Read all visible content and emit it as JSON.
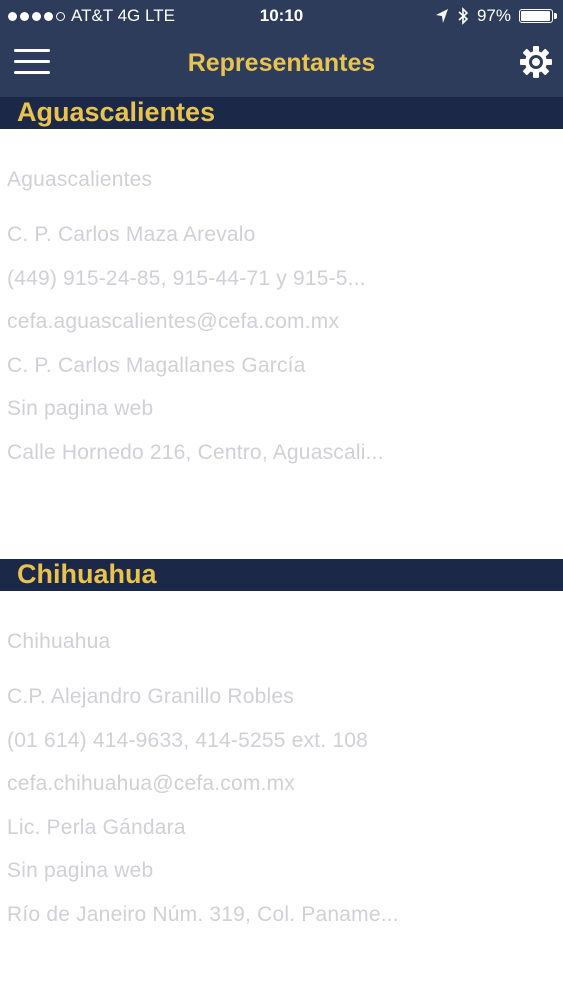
{
  "status_bar": {
    "carrier": "AT&T 4G  LTE",
    "time": "10:10",
    "battery": "97%",
    "battery_level": 0.97
  },
  "nav": {
    "title": "Representantes"
  },
  "sections": [
    {
      "header": "Aguascalientes",
      "lines": [
        "Aguascalientes",
        "C. P. Carlos Maza Arevalo",
        "(449) 915-24-85, 915-44-71 y 915-5...",
        "cefa.aguascalientes@cefa.com.mx",
        "C. P. Carlos Magallanes García",
        "Sin pagina web",
        "Calle Hornedo 216, Centro, Aguascali..."
      ]
    },
    {
      "header": "Chihuahua",
      "lines": [
        "Chihuahua",
        "C.P. Alejandro Granillo Robles",
        "(01 614) 414-9633, 414-5255 ext. 108",
        "cefa.chihuahua@cefa.com.mx",
        "Lic. Perla Gándara",
        "Sin pagina web",
        "Río de Janeiro Núm. 319, Col. Paname..."
      ]
    }
  ],
  "colors": {
    "nav_background": "#2d3c5b",
    "section_background": "#1b2847",
    "accent": "#e8c350",
    "text_muted": "#d0d0d6"
  },
  "icons": {
    "menu": "menu-icon",
    "settings": "gear-icon",
    "location": "location-arrow-icon",
    "bluetooth": "bluetooth-icon",
    "battery": "battery-icon"
  }
}
